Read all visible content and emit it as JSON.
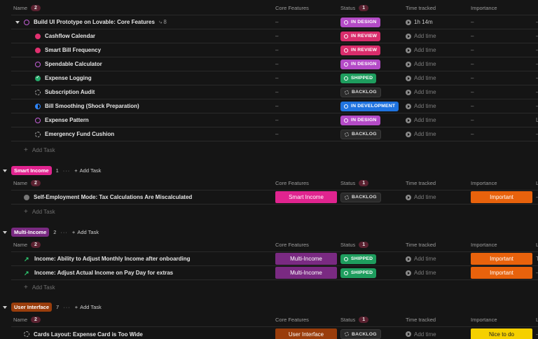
{
  "columns": {
    "name": "Name",
    "name_count": "2",
    "core": "Core Features",
    "status": "Status",
    "status_count": "1",
    "time": "Time tracked",
    "importance": "Importance",
    "last": "L"
  },
  "top_group": {
    "parent": {
      "name": "Build UI Prototype on Lovable: Core Features",
      "subtask_count": "8",
      "core": "–",
      "status": "IN DESIGN",
      "time": "1h 14m",
      "importance": "–",
      "last": "–"
    },
    "subtasks": [
      {
        "name": "Cashflow Calendar",
        "core": "–",
        "status": "IN REVIEW",
        "time": "Add time",
        "importance": "–",
        "last": "–"
      },
      {
        "name": "Smart Bill Frequency",
        "core": "–",
        "status": "IN REVIEW",
        "time": "Add time",
        "importance": "–",
        "last": "–"
      },
      {
        "name": "Spendable Calculator",
        "core": "–",
        "status": "IN DESIGN",
        "time": "Add time",
        "importance": "–",
        "last": "–"
      },
      {
        "name": "Expense Logging",
        "core": "–",
        "status": "SHIPPED",
        "time": "Add time",
        "importance": "–",
        "last": "–"
      },
      {
        "name": "Subscription Audit",
        "core": "–",
        "status": "BACKLOG",
        "time": "Add time",
        "importance": "–",
        "last": "–"
      },
      {
        "name": "Bill Smoothing (Shock Preparation)",
        "core": "–",
        "status": "IN DEVELOPMENT",
        "time": "Add time",
        "importance": "–",
        "last": "–"
      },
      {
        "name": "Expense Pattern",
        "core": "–",
        "status": "IN DESIGN",
        "time": "Add time",
        "importance": "–",
        "last": "L"
      },
      {
        "name": "Emergency Fund Cushion",
        "core": "–",
        "status": "BACKLOG",
        "time": "Add time",
        "importance": "–",
        "last": "–"
      }
    ],
    "add_task": "Add Task"
  },
  "groups": [
    {
      "tag": "Smart Income",
      "count": "1",
      "more": "···",
      "add_task": "Add Task",
      "tasks": [
        {
          "name": "Self-Employment Mode: Tax Calculations Are Miscalculated",
          "core": "Smart Income",
          "status": "BACKLOG",
          "time": "Add time",
          "importance": "Important",
          "last": "–"
        }
      ]
    },
    {
      "tag": "Multi-Income",
      "count": "2",
      "more": "···",
      "add_task": "Add Task",
      "tasks": [
        {
          "name": "Income: Ability to Adjust Monthly Income after onboarding",
          "core": "Multi-Income",
          "status": "SHIPPED",
          "time": "Add time",
          "importance": "Important",
          "last": "T"
        },
        {
          "name": "Income: Adjust Actual Income on Pay Day for extras",
          "core": "Multi-Income",
          "status": "SHIPPED",
          "time": "Add time",
          "importance": "Important",
          "last": "–"
        }
      ]
    },
    {
      "tag": "User Interface",
      "count": "7",
      "more": "···",
      "add_task": "Add Task",
      "tasks": [
        {
          "name": "Cards Layout: Expense Card is Too Wide",
          "core": "User Interface",
          "status": "BACKLOG",
          "time": "Add time",
          "importance": "Nice to do",
          "last": "–"
        }
      ]
    }
  ],
  "colors": {
    "smart_income": "#e0248f",
    "multi_income": "#7a2a82",
    "user_interface": "#9a3d0b",
    "important": "#e8620c",
    "nice_to_do": "#f5d000"
  }
}
